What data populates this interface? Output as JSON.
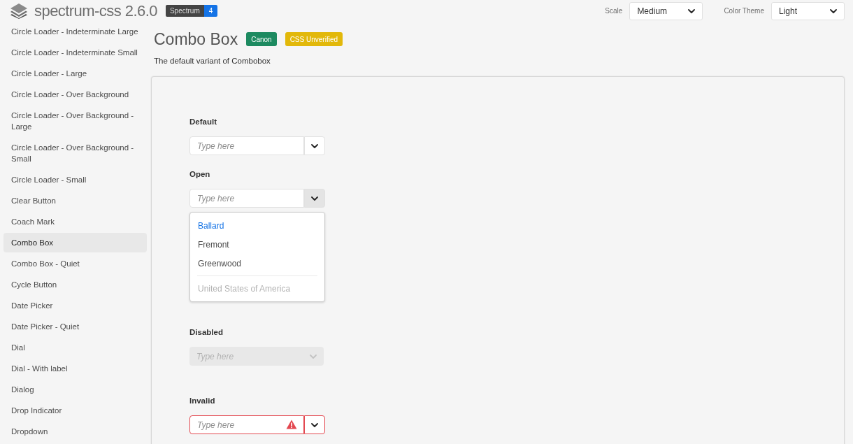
{
  "header": {
    "title": "spectrum-css 2.6.0",
    "badge": {
      "label": "Spectrum",
      "count": "4"
    },
    "pickers": [
      {
        "label": "Scale",
        "value": "Medium"
      },
      {
        "label": "Color Theme",
        "value": "Light"
      }
    ]
  },
  "sidebar": {
    "items": [
      {
        "label": "Circle Loader - Indeterminate Large",
        "selected": false
      },
      {
        "label": "Circle Loader - Indeterminate Small",
        "selected": false
      },
      {
        "label": "Circle Loader - Large",
        "selected": false
      },
      {
        "label": "Circle Loader - Over Background",
        "selected": false
      },
      {
        "label": "Circle Loader - Over Background - Large",
        "selected": false
      },
      {
        "label": "Circle Loader - Over Background - Small",
        "selected": false
      },
      {
        "label": "Circle Loader - Small",
        "selected": false
      },
      {
        "label": "Clear Button",
        "selected": false
      },
      {
        "label": "Coach Mark",
        "selected": false
      },
      {
        "label": "Combo Box",
        "selected": true
      },
      {
        "label": "Combo Box - Quiet",
        "selected": false
      },
      {
        "label": "Cycle Button",
        "selected": false
      },
      {
        "label": "Date Picker",
        "selected": false
      },
      {
        "label": "Date Picker - Quiet",
        "selected": false
      },
      {
        "label": "Dial",
        "selected": false
      },
      {
        "label": "Dial - With label",
        "selected": false
      },
      {
        "label": "Dialog",
        "selected": false
      },
      {
        "label": "Drop Indicator",
        "selected": false
      },
      {
        "label": "Dropdown",
        "selected": false
      }
    ]
  },
  "page": {
    "title": "Combo Box",
    "tags": [
      {
        "label": "Canon",
        "color": "#1d8a60"
      },
      {
        "label": "CSS Unverified",
        "color": "#e2b80a"
      }
    ],
    "description": "The default variant of Combobox"
  },
  "examples": [
    {
      "label": "Default",
      "kind": "default",
      "placeholder": "Type here"
    },
    {
      "label": "Open",
      "kind": "open",
      "placeholder": "Type here",
      "menu": [
        {
          "kind": "item",
          "label": "Ballard",
          "selected": true,
          "disabled": false
        },
        {
          "kind": "item",
          "label": "Fremont",
          "selected": false,
          "disabled": false
        },
        {
          "kind": "item",
          "label": "Greenwood",
          "selected": false,
          "disabled": false
        },
        {
          "kind": "divider"
        },
        {
          "kind": "item",
          "label": "United States of America",
          "selected": false,
          "disabled": true
        }
      ]
    },
    {
      "label": "Disabled",
      "kind": "disabled",
      "placeholder": "Type here"
    },
    {
      "label": "Invalid",
      "kind": "invalid",
      "placeholder": "Type here"
    }
  ]
}
